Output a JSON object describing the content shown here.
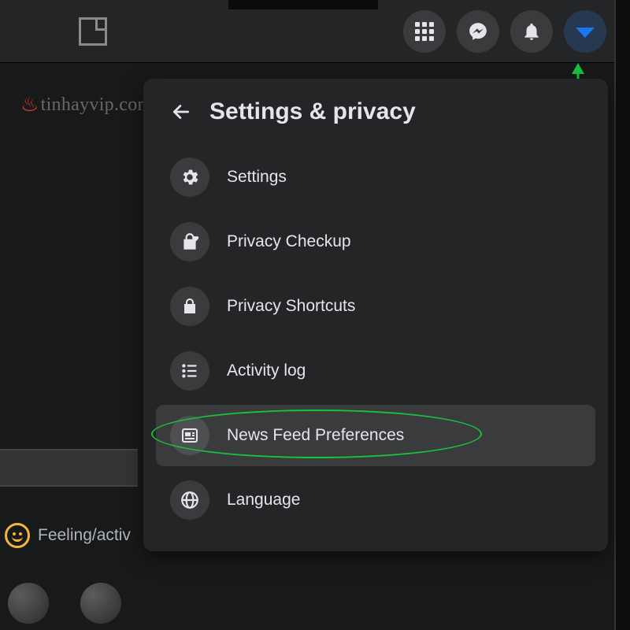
{
  "watermark": "tinhayvip.com",
  "header": {
    "title": "Settings & privacy"
  },
  "menu": {
    "items": [
      {
        "label": "Settings",
        "iconName": "gear-icon"
      },
      {
        "label": "Privacy Checkup",
        "iconName": "lock-heart-icon"
      },
      {
        "label": "Privacy Shortcuts",
        "iconName": "lock-icon"
      },
      {
        "label": "Activity log",
        "iconName": "list-icon"
      },
      {
        "label": "News Feed Preferences",
        "iconName": "feed-icon"
      },
      {
        "label": "Language",
        "iconName": "globe-icon"
      }
    ],
    "highlightedIndex": 4
  },
  "composer": {
    "feelingLabel": "Feeling/activ"
  },
  "topbar": {
    "buttons": [
      "apps",
      "messenger",
      "notifications",
      "account"
    ]
  }
}
